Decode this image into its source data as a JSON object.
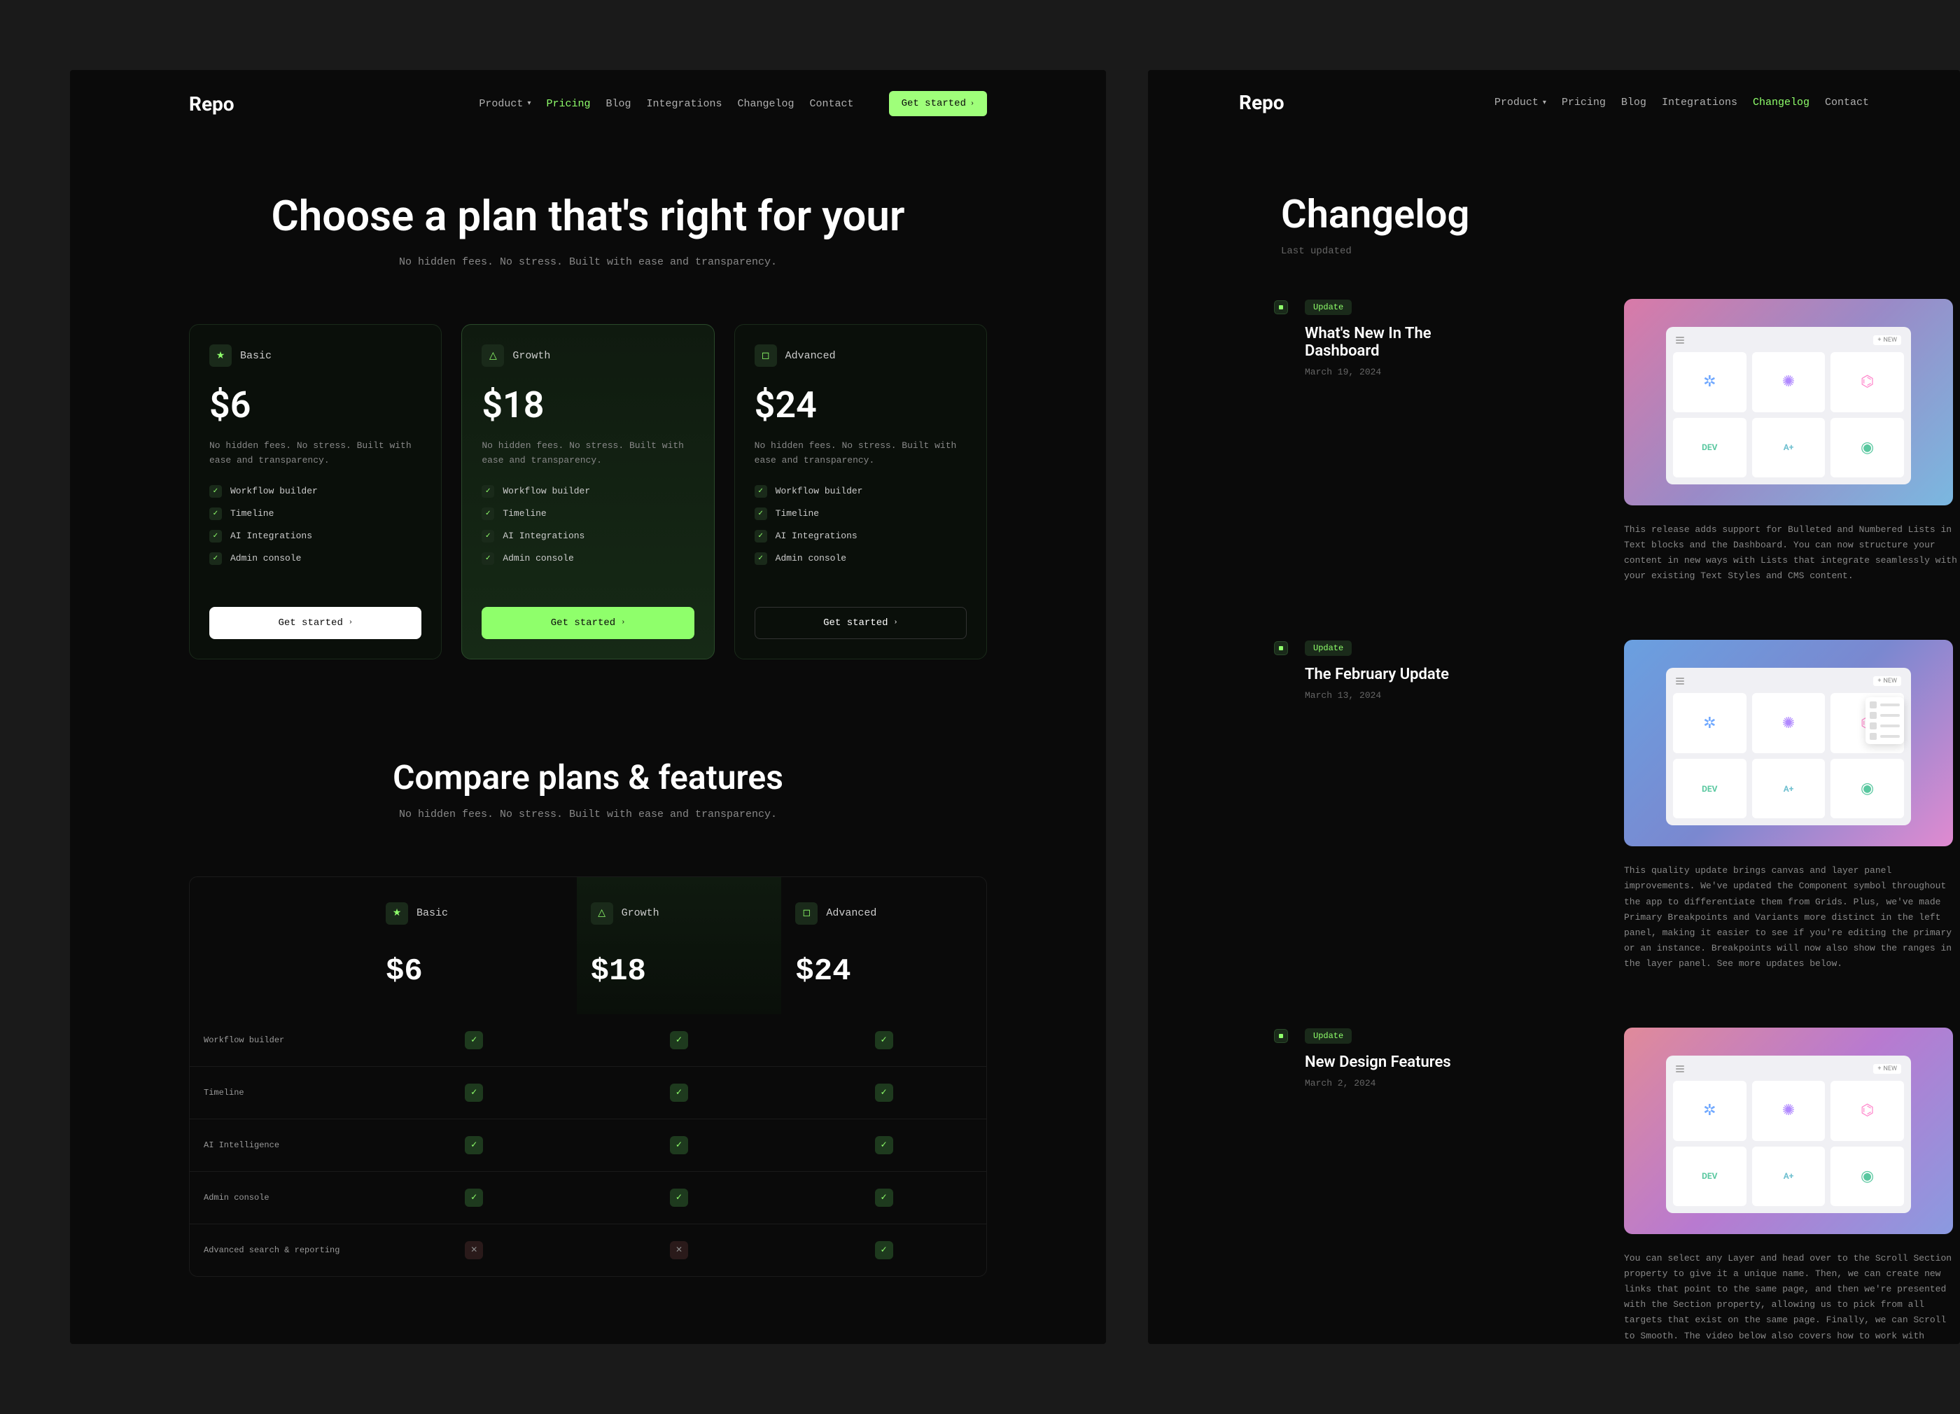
{
  "brand": "Repo",
  "nav": {
    "product": "Product",
    "pricing": "Pricing",
    "blog": "Blog",
    "integrations": "Integrations",
    "changelog": "Changelog",
    "contact": "Contact",
    "cta": "Get started"
  },
  "pricing": {
    "title": "Choose a plan that's right for your",
    "subtitle": "No hidden fees. No stress. Built with ease and transparency.",
    "plans": [
      {
        "name": "Basic",
        "price": "$6",
        "desc": "No hidden fees. No stress. Built with ease and transparency.",
        "cta": "Get started"
      },
      {
        "name": "Growth",
        "price": "$18",
        "desc": "No hidden fees. No stress. Built with ease and transparency.",
        "cta": "Get started"
      },
      {
        "name": "Advanced",
        "price": "$24",
        "desc": "No hidden fees. No stress. Built with ease and transparency.",
        "cta": "Get started"
      }
    ],
    "features": [
      "Workflow builder",
      "Timeline",
      "AI Integrations",
      "Admin console"
    ]
  },
  "compare": {
    "title": "Compare plans & features",
    "subtitle": "No hidden fees. No stress. Built with ease and transparency.",
    "rows": [
      {
        "label": "Workflow builder",
        "vals": [
          true,
          true,
          true
        ]
      },
      {
        "label": "Timeline",
        "vals": [
          true,
          true,
          true
        ]
      },
      {
        "label": "AI Intelligence",
        "vals": [
          true,
          true,
          true
        ]
      },
      {
        "label": "Admin console",
        "vals": [
          true,
          true,
          true
        ]
      },
      {
        "label": "Advanced search & reporting",
        "vals": [
          false,
          false,
          true
        ]
      }
    ]
  },
  "changelog": {
    "title": "Changelog",
    "subtitle": "Last updated",
    "badge": "Update",
    "new_label": "NEW",
    "entries": [
      {
        "title": "What's New In The Dashboard",
        "date": "March 19, 2024",
        "body": "This release adds support for Bulleted and Numbered Lists in Text blocks and the Dashboard. You can now structure your content in new ways with Lists that integrate seamlessly with your existing Text Styles and CMS content."
      },
      {
        "title": "The February Update",
        "date": "March 13, 2024",
        "body": "This quality update brings canvas and layer panel improvements. We've updated the Component symbol throughout the app to differentiate them from Grids. Plus, we've made Primary Breakpoints and Variants more distinct in the left panel, making it easier to see if you're editing the primary or an instance. Breakpoints will now also show the ranges in the layer panel. See more updates below."
      },
      {
        "title": "New Design Features",
        "date": "March 2, 2024",
        "body": "You can select any Layer and head over to the Scroll Section property to give it a unique name. Then, we can create new links that point to the same page, and then we're presented with the Section property, allowing us to pick from all targets that exist on the same page. Finally, we can Scroll to Smooth. The video below also covers how to work with"
      }
    ]
  }
}
